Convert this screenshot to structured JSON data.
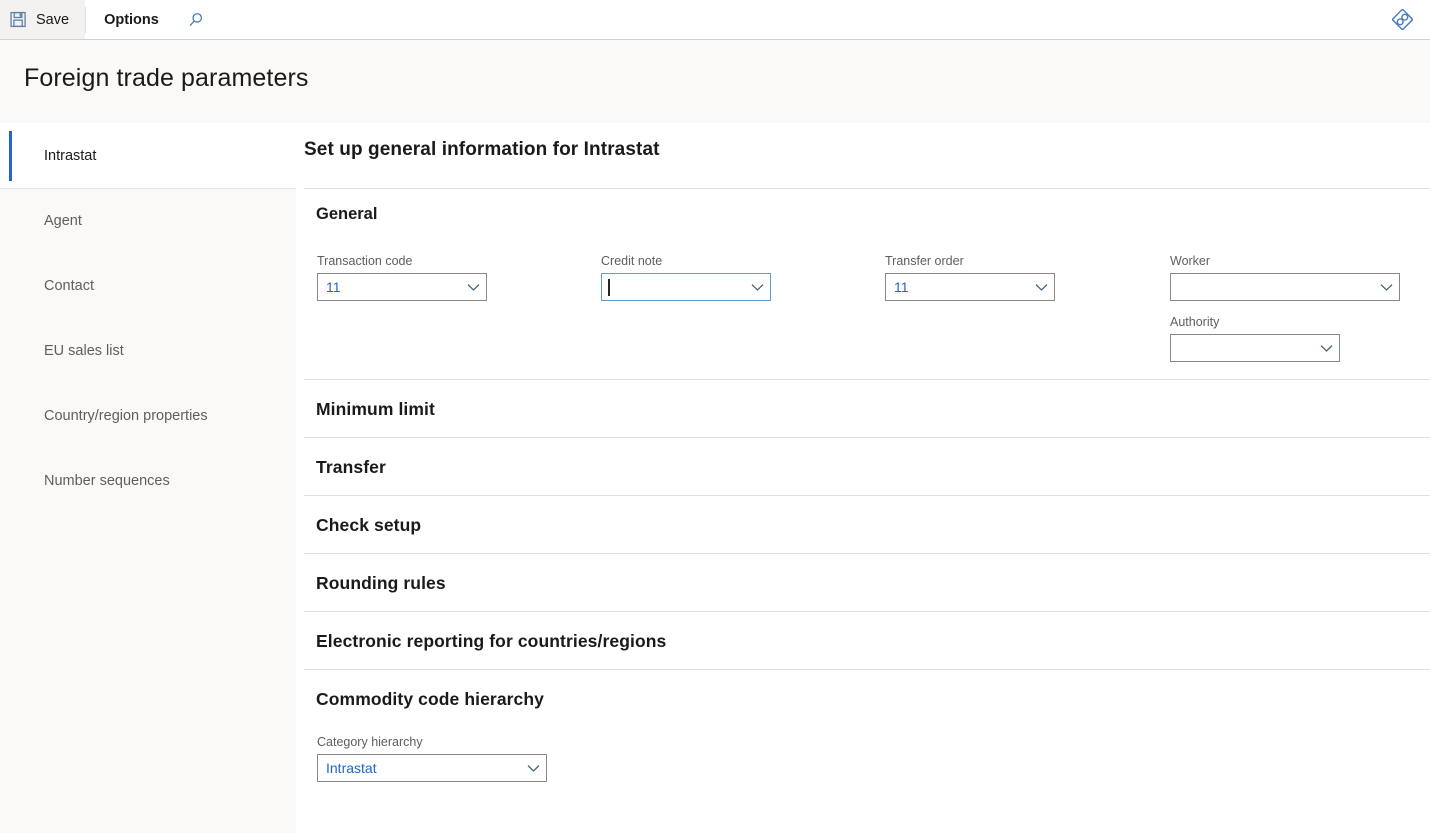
{
  "commandbar": {
    "save_label": "Save",
    "save_icon": "save-floppy-icon",
    "options_label": "Options",
    "search_icon": "search-icon",
    "diagnostics_icon": "diamond-diagnostics-icon"
  },
  "header": {
    "page_title": "Foreign trade parameters"
  },
  "sidebar": {
    "items": [
      {
        "label": "Intrastat",
        "selected": true
      },
      {
        "label": "Agent",
        "selected": false
      },
      {
        "label": "Contact",
        "selected": false
      },
      {
        "label": "EU sales list",
        "selected": false
      },
      {
        "label": "Country/region properties",
        "selected": false
      },
      {
        "label": "Number sequences",
        "selected": false
      }
    ]
  },
  "main": {
    "section_heading": "Set up general information for Intrastat",
    "general": {
      "group_label": "General",
      "fields": [
        {
          "label": "Transaction code",
          "value": "11",
          "placeholder": "",
          "focused": false
        },
        {
          "label": "Credit note",
          "value": "",
          "placeholder": "",
          "focused": true
        },
        {
          "label": "Transfer order",
          "value": "11",
          "placeholder": "",
          "focused": false
        },
        {
          "label": "Worker",
          "value": "",
          "placeholder": "",
          "focused": false
        },
        {
          "label": "Authority",
          "value": "",
          "placeholder": "",
          "focused": false
        }
      ]
    },
    "fasttabs": [
      {
        "title": "Minimum limit",
        "expanded": false
      },
      {
        "title": "Transfer",
        "expanded": false
      },
      {
        "title": "Check setup",
        "expanded": false
      },
      {
        "title": "Rounding rules",
        "expanded": false
      },
      {
        "title": "Electronic reporting for countries/regions",
        "expanded": false
      },
      {
        "title": "Commodity code hierarchy",
        "expanded": true
      }
    ],
    "commodity": {
      "category_hierarchy_label": "Category hierarchy",
      "category_hierarchy_value": "Intrastat"
    }
  },
  "colors": {
    "accent_blue": "#2266cc",
    "focus_border": "#6699cc",
    "field_border": "#8a8886",
    "divider": "#e1dfdd",
    "page_bg": "#faf9f8",
    "text_primary": "#1b1a19",
    "text_secondary": "#605e5c"
  }
}
